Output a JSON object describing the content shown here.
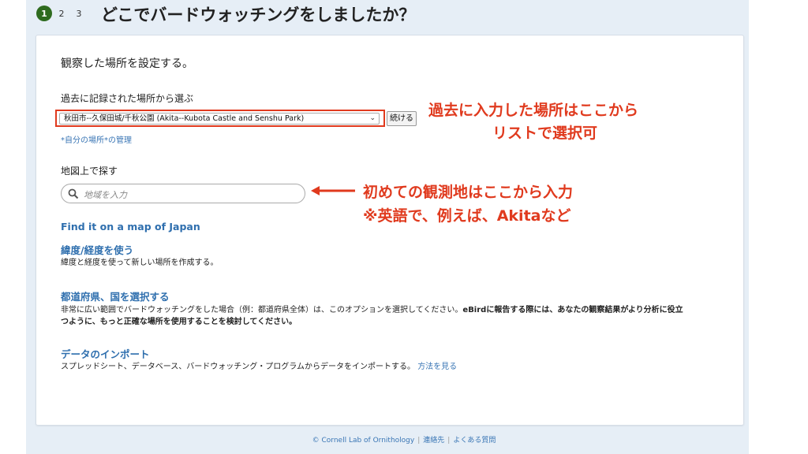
{
  "steps": [
    "1",
    "2",
    "3"
  ],
  "heading": "どこでバードウォッチングをしましたか？",
  "card": {
    "title": "観察した場所を設定する。",
    "past_label": "過去に記録された場所から選ぶ",
    "past_select_value": "秋田市--久保田城/千秋公園 (Akita--Kubota Castle and Senshu Park)",
    "continue_label": "続ける",
    "manage_link": "*自分の場所*の管理",
    "map_label": "地図上で探す",
    "search_placeholder": "地域を入力",
    "find_map_link": "Find it on a map of Japan",
    "latlng_link": "緯度/経度を使う",
    "latlng_desc": "緯度と経度を使って新しい場所を作成する。",
    "pref_link": "都道府県、国を選択する",
    "pref_desc_1a": "非常に広い範囲でバードウォッチングをした場合（例：都道府県全体）は、このオプションを選択してください。",
    "pref_desc_1b": "eBirdに報告する際には、あなたの観察結果がより分析に役立",
    "pref_desc_2": "つように、もっと正確な場所を使用することを検討してください。",
    "import_link": "データのインポート",
    "import_desc": "スプレッドシート、データベース、バードウォッチング・プログラムからデータをインポートする。",
    "import_howto_link": "方法を見る"
  },
  "annotations": {
    "past_line1": "過去に入力した場所はここから",
    "past_line2": "リストで選択可",
    "new_line1": "初めての観測地はここから入力",
    "new_line2": "※英語で、例えば、Akitaなど"
  },
  "footer": {
    "copyright": "© Cornell Lab of Ornithology",
    "contact": "連絡先",
    "faq": "よくある質問"
  },
  "colors": {
    "accent_red": "#e03a1e",
    "link_blue": "#2f6fae",
    "step_green": "#2e6b1f",
    "page_bg": "#e6eef6"
  }
}
